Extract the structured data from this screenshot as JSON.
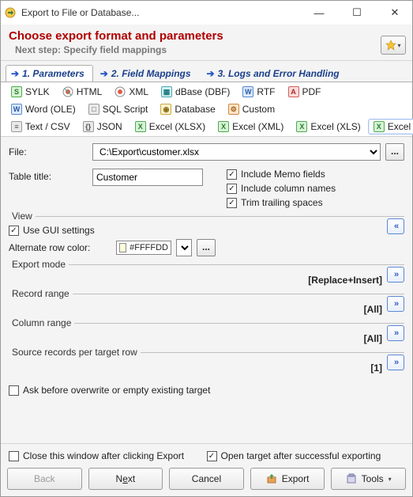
{
  "window": {
    "title": "Export to File or Database..."
  },
  "header": {
    "title": "Choose export format and parameters",
    "next": "Next step: Specify field mappings"
  },
  "tabs": {
    "t1": "1. Parameters",
    "t2": "2. Field Mappings",
    "t3": "3. Logs and Error Handling"
  },
  "formats": {
    "sylk": "SYLK",
    "html": "HTML",
    "xml": "XML",
    "dbase": "dBase (DBF)",
    "rtf": "RTF",
    "pdf": "PDF",
    "word": "Word (OLE)",
    "sql": "SQL Script",
    "db": "Database",
    "custom": "Custom",
    "csv": "Text / CSV",
    "json": "JSON",
    "xlsx": "Excel (XLSX)",
    "xlsxml": "Excel (XML)",
    "xls": "Excel (XLS)",
    "xole": "Excel (OLE)"
  },
  "file": {
    "label": "File:",
    "path": "C:\\Export\\customer.xlsx"
  },
  "tableTitle": {
    "label": "Table title:",
    "value": "Customer"
  },
  "checks": {
    "memo": "Include Memo fields",
    "cols": "Include column names",
    "trim": "Trim trailing spaces"
  },
  "view": {
    "legend": "View",
    "useGui": "Use GUI settings",
    "altLabel": "Alternate row color:",
    "altColor": "#FFFFDD"
  },
  "groups": {
    "exportMode": {
      "name": "Export mode",
      "value": "[Replace+Insert]"
    },
    "recordRange": {
      "name": "Record range",
      "value": "[All]"
    },
    "columnRange": {
      "name": "Column range",
      "value": "[All]"
    },
    "perRow": {
      "name": "Source records per target row",
      "value": "[1]"
    }
  },
  "askOverwrite": "Ask before overwrite or empty existing target",
  "footerChecks": {
    "close": "Close this window after clicking Export",
    "open": "Open target after successful exporting"
  },
  "buttons": {
    "back": "Back",
    "next_pre": "N",
    "next_acc": "e",
    "next_post": "xt",
    "cancel": "Cancel",
    "export": "Export",
    "tools": "Tools"
  }
}
